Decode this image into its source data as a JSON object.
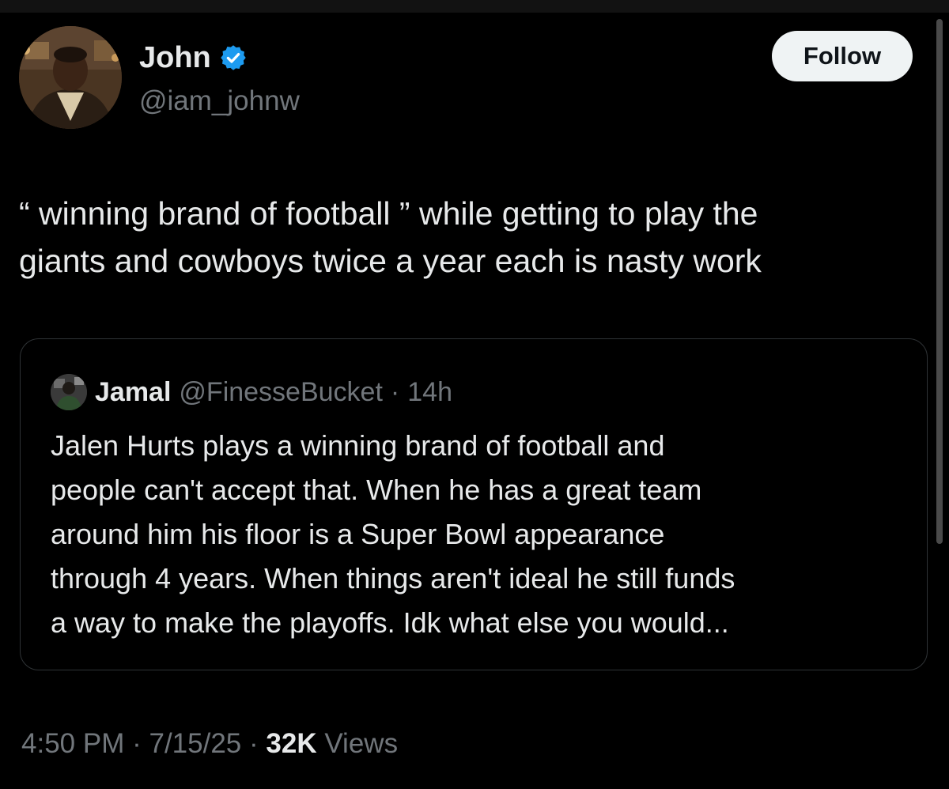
{
  "author": {
    "display_name": "John",
    "handle": "@iam_johnw",
    "verified": true,
    "avatar_icon": "profile-photo"
  },
  "actions": {
    "follow_label": "Follow"
  },
  "tweet": {
    "text": "“ winning brand of football ” while getting to play the\ngiants and cowboys twice a year each is nasty work"
  },
  "quoted_tweet": {
    "display_name": "Jamal",
    "handle": "@FinesseBucket",
    "separator": "·",
    "time": "14h",
    "avatar_icon": "profile-photo",
    "text": "Jalen Hurts plays a winning brand of football and\npeople can't accept that. When he has a great team\naround him his floor is a Super Bowl appearance\nthrough 4 years. When things aren't ideal he still funds\na way to make the playoffs. Idk what else you would..."
  },
  "meta": {
    "time": "4:50 PM",
    "separator": "·",
    "date": "7/15/25",
    "views_count": "32K",
    "views_label": "Views"
  },
  "colors": {
    "background": "#000000",
    "text_primary": "#e7e9ea",
    "text_secondary": "#71767b",
    "verified_badge": "#1d9bf0",
    "follow_button_bg": "#eff3f4",
    "border": "#2f3336"
  }
}
